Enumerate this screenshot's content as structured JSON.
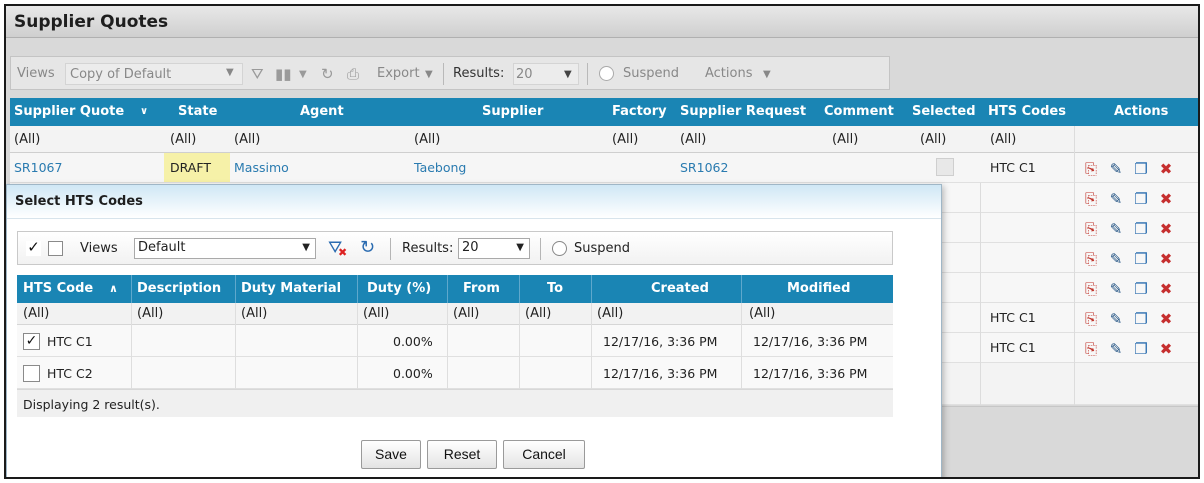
{
  "page": {
    "title": "Supplier Quotes",
    "toolbar": {
      "views_label": "Views",
      "views_value": "Copy of Default",
      "export_label": "Export",
      "results_label": "Results:",
      "results_value": "20",
      "suspend_label": "Suspend",
      "actions_label": "Actions"
    },
    "columns": [
      "Supplier Quote",
      "State",
      "Agent",
      "Supplier",
      "Factory",
      "Supplier Request",
      "Comment",
      "Selected",
      "HTS Codes",
      "Actions"
    ],
    "filter_all": "(All)",
    "rows": [
      {
        "quote": "SR1067",
        "state": "DRAFT",
        "agent": "Massimo",
        "supplier": "Taebong",
        "request": "SR1062",
        "hts": "HTC C1"
      }
    ],
    "visible_hts": [
      "HTC C1",
      "HTC C1"
    ]
  },
  "modal": {
    "title": "Select HTS Codes",
    "toolbar": {
      "views_label": "Views",
      "views_value": "Default",
      "results_label": "Results:",
      "results_value": "20",
      "suspend_label": "Suspend"
    },
    "columns": [
      "HTS Code",
      "Description",
      "Duty Material",
      "Duty (%)",
      "From",
      "To",
      "Created",
      "Modified"
    ],
    "filter_all": "(All)",
    "rows": [
      {
        "checked": true,
        "code": "HTC C1",
        "duty": "0.00%",
        "created": "12/17/16, 3:36 PM",
        "modified": "12/17/16, 3:36 PM"
      },
      {
        "checked": false,
        "code": "HTC C2",
        "duty": "0.00%",
        "created": "12/17/16, 3:36 PM",
        "modified": "12/17/16, 3:36 PM"
      }
    ],
    "status": "Displaying 2 result(s).",
    "buttons": {
      "save": "Save",
      "reset": "Reset",
      "cancel": "Cancel"
    }
  },
  "colors": {
    "header_blue": "#1a85b4",
    "link_blue": "#2a7bb0",
    "draft_yellow": "#f6f1a8"
  }
}
